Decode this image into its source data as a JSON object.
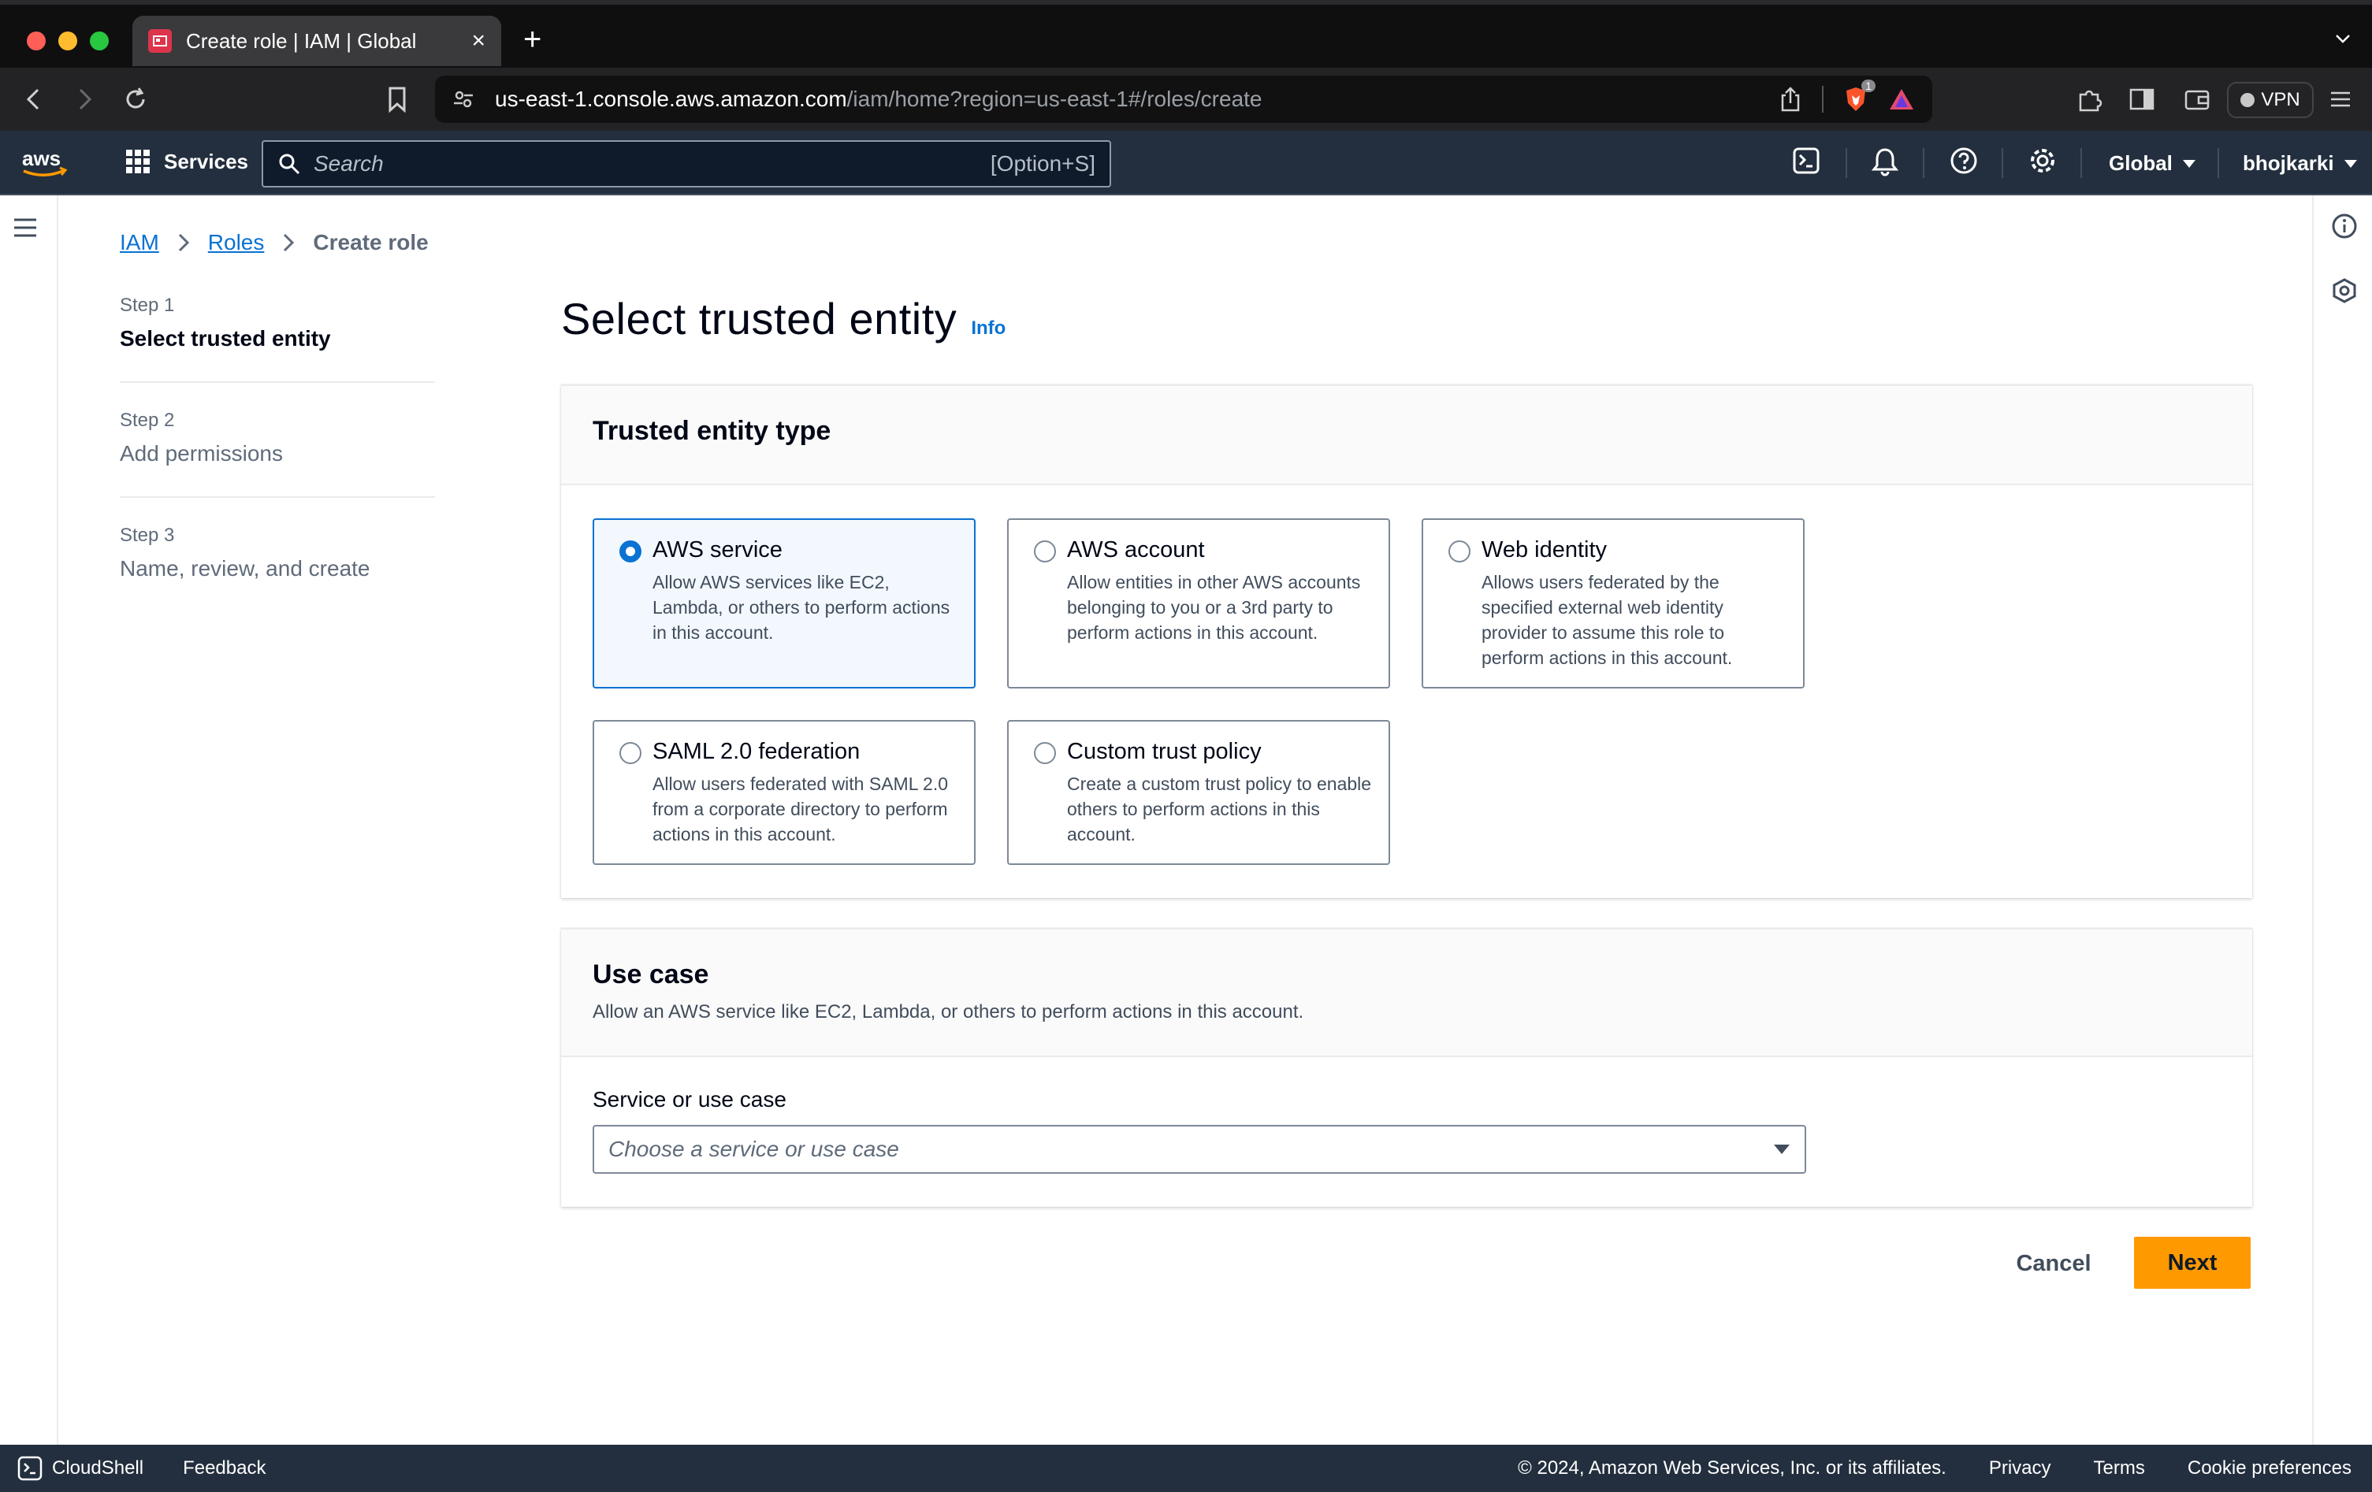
{
  "browser": {
    "tab_title": "Create role | IAM | Global",
    "url_host": "us-east-1.console.aws.amazon.com",
    "url_path": "/iam/home?region=us-east-1#/roles/create",
    "shields_count": "1",
    "vpn_label": "VPN"
  },
  "aws_nav": {
    "logo_text": "aws",
    "services_label": "Services",
    "search_placeholder": "Search",
    "search_shortcut": "[Option+S]",
    "region_label": "Global",
    "user_label": "bhojkarki"
  },
  "breadcrumb": {
    "items": [
      {
        "label": "IAM"
      },
      {
        "label": "Roles"
      },
      {
        "label": "Create role"
      }
    ]
  },
  "steps": [
    {
      "num": "Step 1",
      "label": "Select trusted entity",
      "active": true
    },
    {
      "num": "Step 2",
      "label": "Add permissions",
      "active": false
    },
    {
      "num": "Step 3",
      "label": "Name, review, and create",
      "active": false
    }
  ],
  "page": {
    "title": "Select trusted entity",
    "info_label": "Info"
  },
  "trusted_entity": {
    "heading": "Trusted entity type",
    "options": [
      {
        "title": "AWS service",
        "desc": "Allow AWS services like EC2, Lambda, or others to perform actions in this account.",
        "selected": true
      },
      {
        "title": "AWS account",
        "desc": "Allow entities in other AWS accounts belonging to you or a 3rd party to perform actions in this account.",
        "selected": false
      },
      {
        "title": "Web identity",
        "desc": "Allows users federated by the specified external web identity provider to assume this role to perform actions in this account.",
        "selected": false
      },
      {
        "title": "SAML 2.0 federation",
        "desc": "Allow users federated with SAML 2.0 from a corporate directory to perform actions in this account.",
        "selected": false
      },
      {
        "title": "Custom trust policy",
        "desc": "Create a custom trust policy to enable others to perform actions in this account.",
        "selected": false
      }
    ]
  },
  "use_case": {
    "heading": "Use case",
    "description": "Allow an AWS service like EC2, Lambda, or others to perform actions in this account.",
    "field_label": "Service or use case",
    "select_placeholder": "Choose a service or use case"
  },
  "actions": {
    "cancel_label": "Cancel",
    "next_label": "Next"
  },
  "footer": {
    "cloudshell_label": "CloudShell",
    "feedback_label": "Feedback",
    "copyright": "© 2024, Amazon Web Services, Inc. or its affiliates.",
    "privacy_label": "Privacy",
    "terms_label": "Terms",
    "cookie_label": "Cookie preferences"
  },
  "colors": {
    "aws_nav_bg": "#232f3e",
    "link_blue": "#0972d3",
    "primary_orange": "#ff9900",
    "selected_tile_bg": "#f2f8fd"
  },
  "icons": [
    "close-icon",
    "new-tab-icon",
    "back-icon",
    "forward-icon",
    "reload-icon",
    "bookmark-icon",
    "site-settings-icon",
    "share-icon",
    "brave-shields-icon",
    "brave-rewards-icon",
    "extensions-icon",
    "sidebar-icon",
    "wallet-icon",
    "menu-icon",
    "grid-icon",
    "search-icon",
    "cloudshell-icon",
    "bell-icon",
    "help-icon",
    "gear-icon",
    "caret-down-icon",
    "hamburger-icon",
    "info-icon",
    "security-icon",
    "chevron-right-icon"
  ]
}
